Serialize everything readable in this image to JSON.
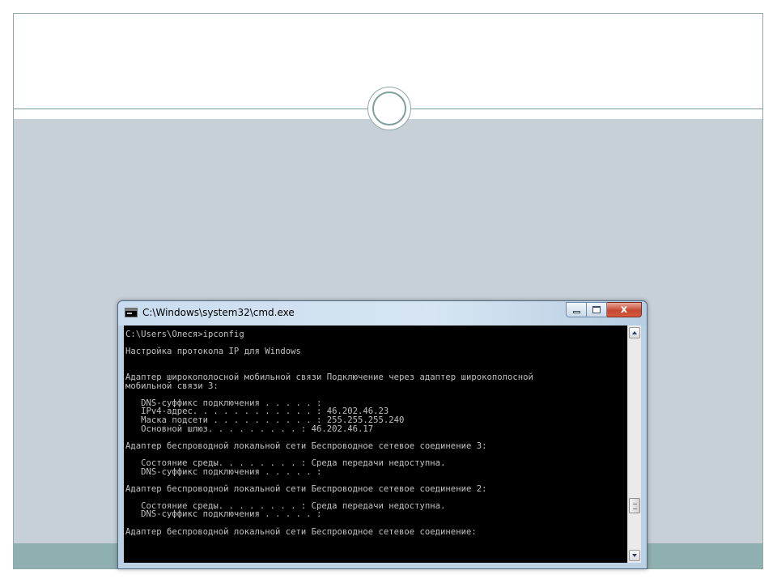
{
  "window": {
    "title": "C:\\Windows\\system32\\cmd.exe",
    "controls": {
      "close_glyph": "x"
    }
  },
  "console": {
    "lines": [
      "C:\\Users\\Олеся>ipconfig",
      "",
      "Настройка протокола IP для Windows",
      "",
      "",
      "Адаптер широкополосной мобильной связи Подключение через адаптер широкополосной",
      "мобильной связи 3:",
      "",
      "   DNS-суффикс подключения . . . . . :",
      "   IPv4-адрес. . . . . . . . . . . . : 46.202.46.23",
      "   Маска подсети . . . . . . . . . . : 255.255.255.240",
      "   Основной шлюз. . . . . . . . . : 46.202.46.17",
      "",
      "Адаптер беспроводной локальной сети Беспроводное сетевое соединение 3:",
      "",
      "   Состояние среды. . . . . . . . : Среда передачи недоступна.",
      "   DNS-суффикс подключения . . . . . :",
      "",
      "Адаптер беспроводной локальной сети Беспроводное сетевое соединение 2:",
      "",
      "   Состояние среды. . . . . . . . : Среда передачи недоступна.",
      "   DNS-суффикс подключения . . . . . :",
      "",
      "Адаптер беспроводной локальной сети Беспроводное сетевое соединение:"
    ]
  },
  "colors": {
    "console_bg": "#000000",
    "console_text": "#c0c0c0",
    "slide_body": "#c6d0d6",
    "slide_footer": "#8fb0b0",
    "close_button": "#c7482f"
  },
  "icons": {
    "window_icon": "cmd-icon",
    "minimize": "minimize-icon",
    "maximize": "maximize-icon",
    "close": "close-icon",
    "scroll_up": "arrow-up-icon",
    "scroll_down": "arrow-down-icon"
  }
}
